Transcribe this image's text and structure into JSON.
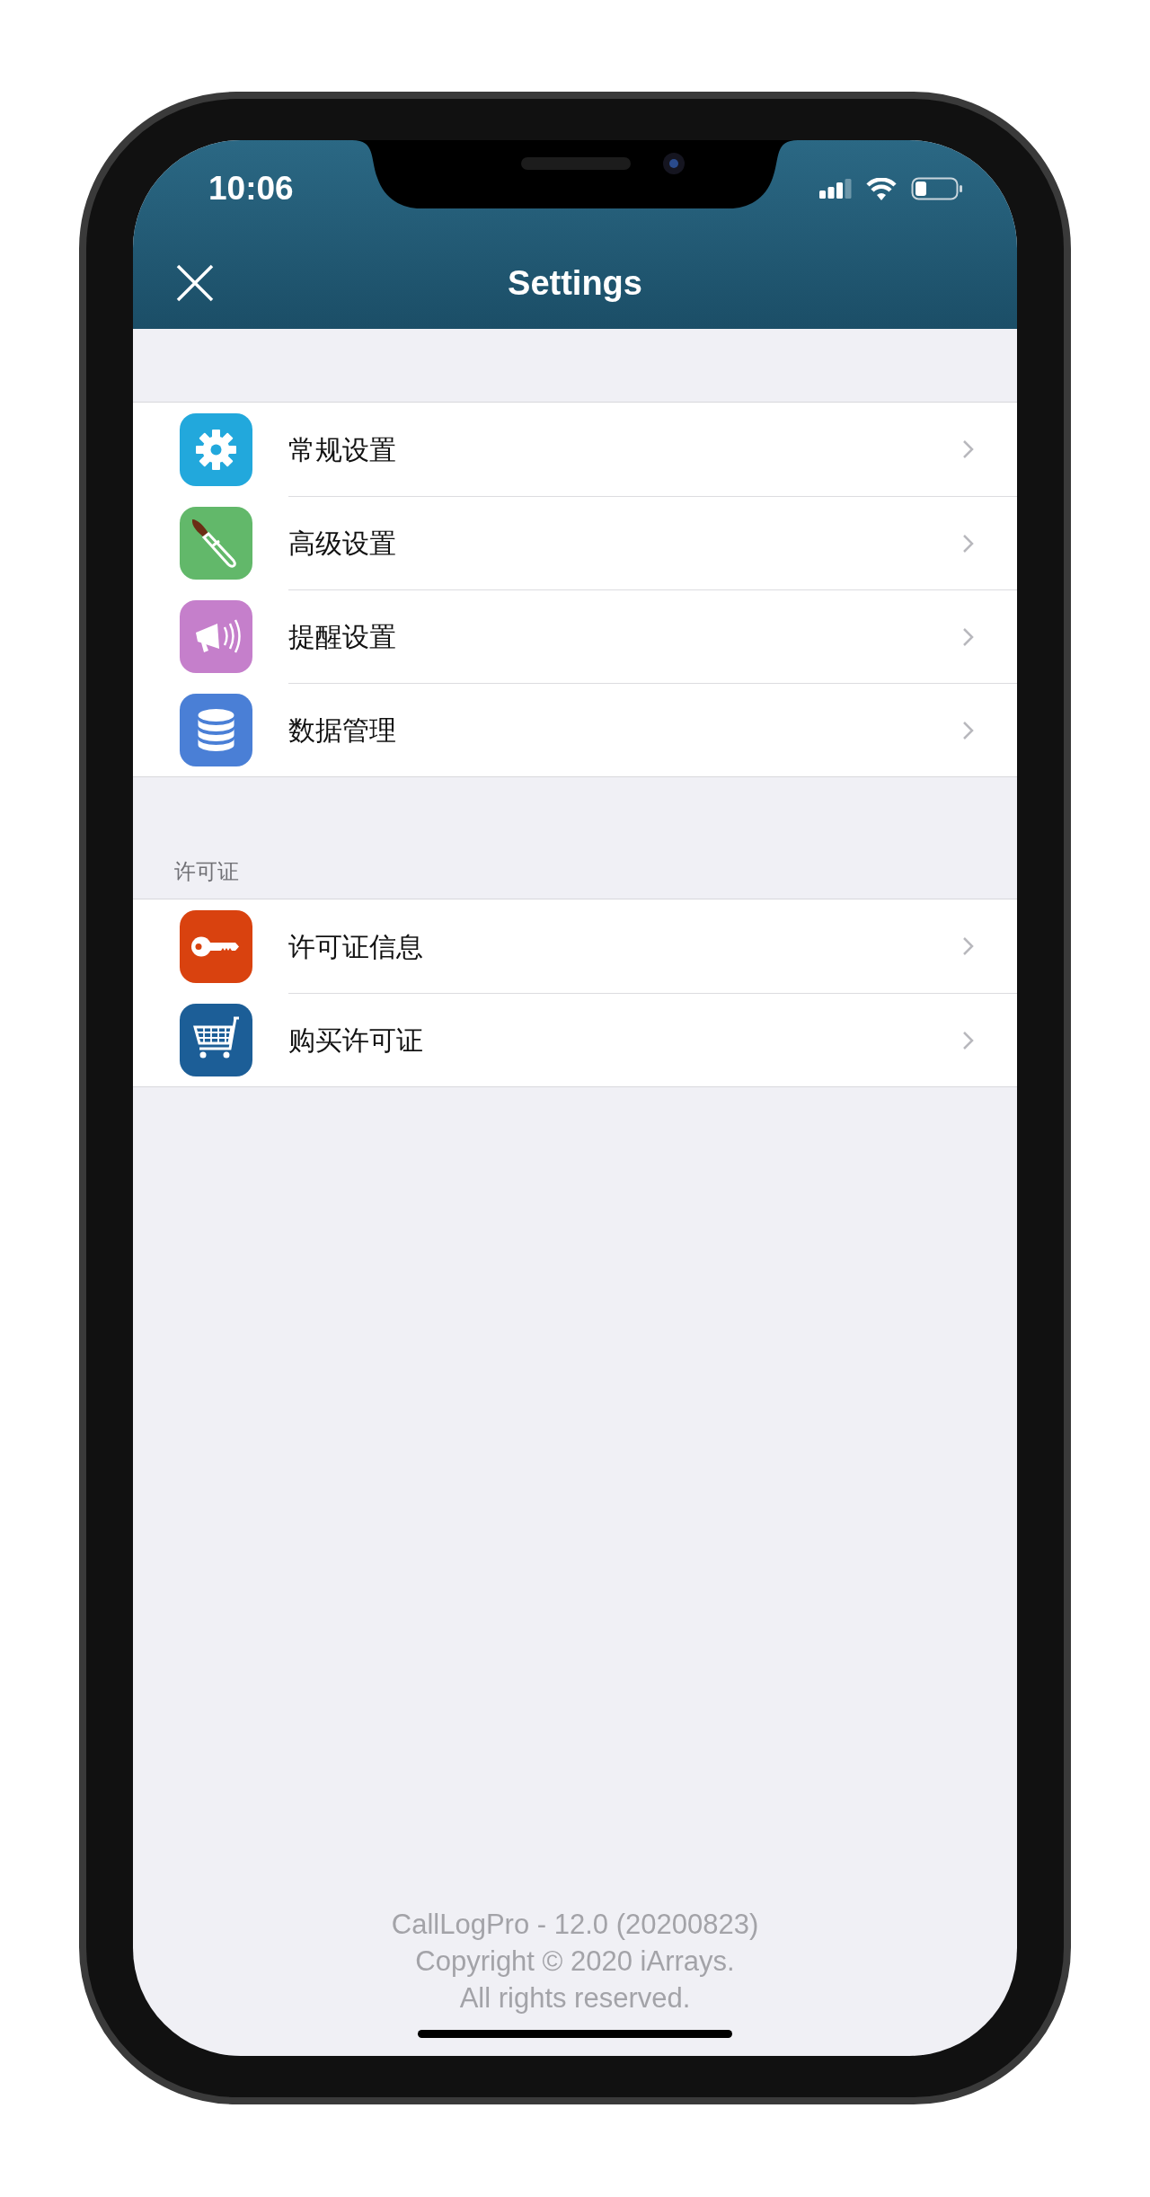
{
  "status_bar": {
    "time": "10:06"
  },
  "nav_bar": {
    "title": "Settings"
  },
  "sections": [
    {
      "items": [
        {
          "label": "常规设置",
          "color": "#22a8dc"
        },
        {
          "label": "高级设置",
          "color": "#62b86a"
        },
        {
          "label": "提醒设置",
          "color": "#c57fcb"
        },
        {
          "label": "数据管理",
          "color": "#4a7fd6"
        }
      ]
    },
    {
      "header": "许可证",
      "items": [
        {
          "label": "许可证信息",
          "color": "#d9420f"
        },
        {
          "label": "购买许可证",
          "color": "#1c5e97"
        }
      ]
    }
  ],
  "footer": [
    "CallLogPro - 12.0 (20200823)",
    "Copyright © 2020 iArrays.",
    "All rights reserved."
  ]
}
